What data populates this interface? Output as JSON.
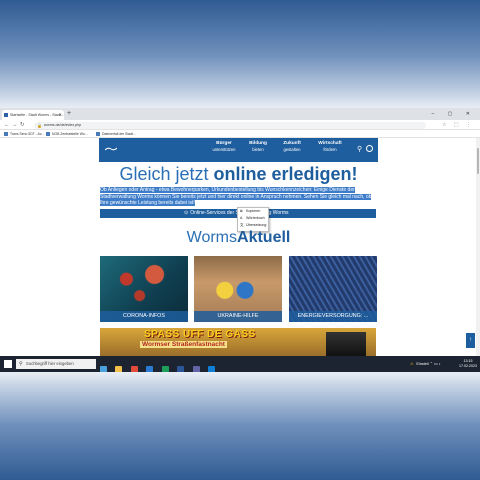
{
  "browser": {
    "tab_title": "Startseite - Stadt Worms - Stadt...",
    "new_tab": "+",
    "window_controls": "– ▢ ✕",
    "address": "worms.de/de/index.php",
    "bookmarks": [
      "Trans Sera GDT - Av...",
      "NOB Zentralstelle Wo...",
      "Datenerfall der Stadt..."
    ]
  },
  "site": {
    "nav": [
      {
        "title": "Bürger",
        "sub": "unterstützen"
      },
      {
        "title": "Bildung",
        "sub": "bieten"
      },
      {
        "title": "Zukunft",
        "sub": "gestalten"
      },
      {
        "title": "Wirtschaft",
        "sub": "fördern"
      }
    ],
    "headline_a": "Gleich jetzt ",
    "headline_b": "online erledigen!",
    "intro": "Ob Anliegen oder Antrag - etwa Bewohnerparken, Urkundenbestellung bis Wunschkennzeichen: Einige Dienste der Stadtverwaltung Worms können Sie bereits jetzt und hier direkt online in Anspruch nehmen. Sehen Sie gleich mal nach, ob Ihre gewünschte Leistung bereits dabei ist!",
    "cta_dot": "⊙",
    "cta": "Online-Services der Stadtverwaltung Worms",
    "section_a": "Worms",
    "section_b": "Aktuell",
    "cards": [
      "CORONA-INFOS",
      "UKRAINE-HILFE",
      "ENERGIEVERSORGUNG: ..."
    ],
    "banner_title": "SPASS UFF DE GASS",
    "banner_sub": "Wormser Straßenfastnacht",
    "scroll_top": "↑"
  },
  "context_menu": [
    {
      "icon": "⧉",
      "label": "Kopieren"
    },
    {
      "icon": "A",
      "label": "Wörterbuch"
    },
    {
      "icon": "文",
      "label": "Übersetzung"
    }
  ],
  "taskbar": {
    "search_placeholder": "Suchbegriff hier eingeben",
    "tray_text": "Einstell",
    "clock_time": "13:15",
    "clock_date": "17.02.2023"
  }
}
